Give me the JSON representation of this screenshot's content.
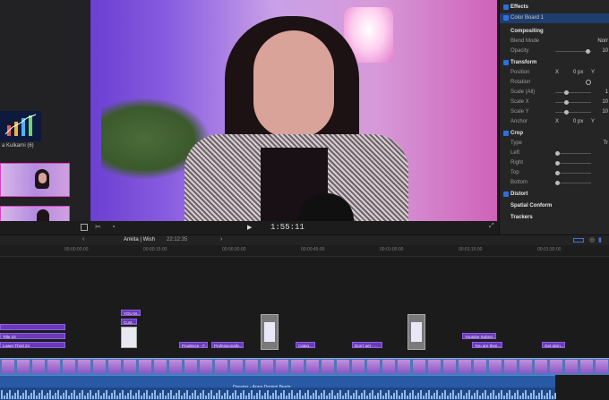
{
  "browser": {
    "clip_label": "a Kulkarni (6)"
  },
  "viewer": {
    "timecode": "1:55:11"
  },
  "inspector": {
    "effects_label": "Effects",
    "color_board_label": "Color Board 1",
    "compositing_label": "Compositing",
    "blend_mode_label": "Blend Mode",
    "blend_mode_value": "Norr",
    "opacity_label": "Opacity",
    "opacity_value": "10",
    "transform_label": "Transform",
    "position_label": "Position",
    "position_x": "X",
    "position_x_value": "0 px",
    "position_y": "Y",
    "rotation_label": "Rotation",
    "scale_all_label": "Scale (All)",
    "scale_all_value": "1",
    "scale_x_label": "Scale X",
    "scale_x_value": "10",
    "scale_y_label": "Scale Y",
    "scale_y_value": "10",
    "anchor_label": "Anchor",
    "anchor_x": "X",
    "anchor_x_value": "0 px",
    "anchor_y": "Y",
    "crop_label": "Crop",
    "type_label": "Type",
    "type_value": "Tr",
    "left_label": "Left",
    "right_label": "Right",
    "top_label": "Top",
    "bottom_label": "Bottom",
    "distort_label": "Distort",
    "spatial_conform_label": "Spatial Conform",
    "trackers_label": "Trackers"
  },
  "timeline": {
    "project_name": "Ankita | Wish",
    "project_duration": "22:12:35",
    "ruler_ticks": [
      "00:00:00:00",
      "00:00:15:00",
      "00:00:30:00",
      "00:00:45:00",
      "00:01:00:00",
      "00:01:15:00",
      "00:01:30:00"
    ],
    "title_clips": [
      {
        "label": ""
      },
      {
        "label": "Title 23"
      },
      {
        "label": "Lower Third 23"
      },
      {
        "label": "YOU M..."
      },
      {
        "label": "Cust..."
      },
      {
        "label": "Prudence - F..."
      },
      {
        "label": "Professionally..."
      },
      {
        "label": "Categ..."
      },
      {
        "label": "Don't get - ..."
      },
      {
        "label": "Youtube Subscr..."
      },
      {
        "label": "You are then..."
      },
      {
        "label": "Get givin..."
      }
    ],
    "audio_label": "Dreams - Anno Domini Beats"
  }
}
